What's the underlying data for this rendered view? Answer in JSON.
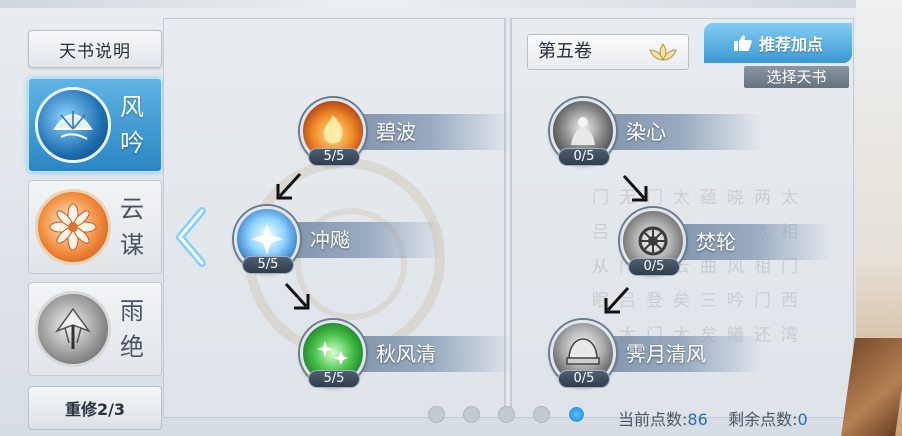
{
  "sidebar": {
    "book_info_label": "天书说明",
    "books": [
      {
        "name_line1": "风",
        "name_line2": "吟",
        "emblem": "fan-emblem-icon",
        "active": true
      },
      {
        "name_line1": "云",
        "name_line2": "谋",
        "emblem": "lotus-flower-emblem-icon",
        "active": false
      },
      {
        "name_line1": "雨",
        "name_line2": "绝",
        "emblem": "umbrella-emblem-icon",
        "active": false
      }
    ],
    "reset_label": "重修2/3"
  },
  "left_tree": {
    "skills": [
      {
        "name": "碧波",
        "level": "5/5",
        "icon": "fire-fist-icon"
      },
      {
        "name": "冲飚",
        "level": "5/5",
        "icon": "ice-burst-icon"
      },
      {
        "name": "秋风清",
        "level": "5/5",
        "icon": "green-sparkle-icon"
      }
    ]
  },
  "right_tree": {
    "volume_label": "第五卷",
    "recommend_label": "推荐加点",
    "choose_book_label": "选择天书",
    "skills": [
      {
        "name": "染心",
        "level": "0/5",
        "icon": "meditation-figure-icon"
      },
      {
        "name": "焚轮",
        "level": "0/5",
        "icon": "wheel-icon"
      },
      {
        "name": "霁月清风",
        "level": "0/5",
        "icon": "helmet-icon"
      }
    ],
    "watermark_text": "太 相 门 西 湾 两 太 相 门 还 晓 三 风 吟 曦 蕴 别 曲 三 矣 太 为 云 矣 太 门 无 湾 登 门 无 湾 门 吕 太 门 吕 从 眠 之"
  },
  "pagination": {
    "total": 5,
    "current": 5
  },
  "points": {
    "current_label": "当前点数:",
    "current_value": "86",
    "remaining_label": "剩余点数:",
    "remaining_value": "0"
  },
  "colors": {
    "accent_blue": "#3b98d2",
    "points_blue": "#2b6fb3"
  }
}
